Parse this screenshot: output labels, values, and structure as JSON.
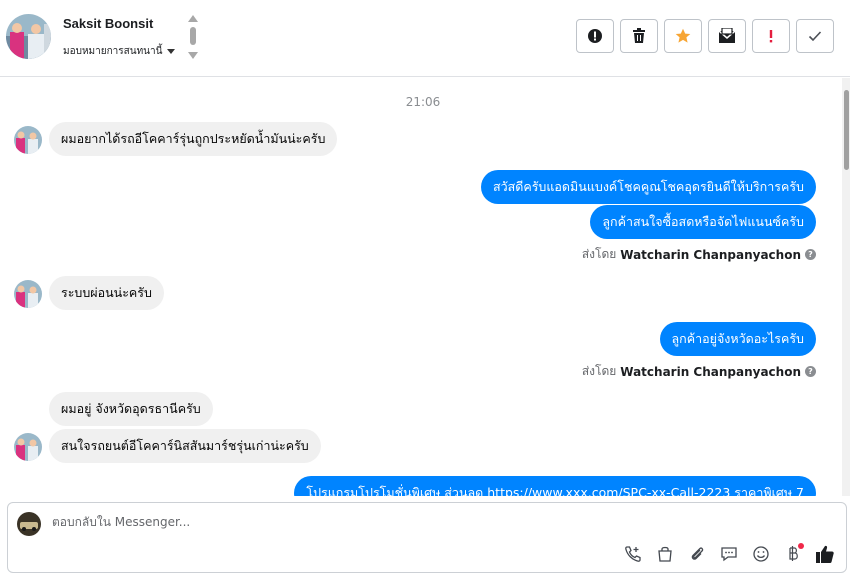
{
  "header": {
    "contact_name": "Saksit Boonsit",
    "assign_label": "มอบหมายการสนทนานี้",
    "actions": [
      {
        "name": "spam-alert-button",
        "icon": "alert-circle-icon"
      },
      {
        "name": "delete-button",
        "icon": "trash-icon"
      },
      {
        "name": "star-button",
        "icon": "star-icon"
      },
      {
        "name": "mark-unread-button",
        "icon": "envelope-icon"
      },
      {
        "name": "follow-up-button",
        "icon": "exclamation-icon"
      },
      {
        "name": "mark-done-button",
        "icon": "checkmark-icon"
      }
    ]
  },
  "chat": {
    "timestamp": "21:06",
    "messages": [
      {
        "dir": "in",
        "text": "ผมอยากได้รถอีโคคาร์รุ่นถูกประหยัดน้ำมันน่ะครับ"
      },
      {
        "dir": "out",
        "text": "สวัสดีครับแอดมินแบงค์โชคคูณโชคอุดรยินดีให้บริการครับ"
      },
      {
        "dir": "out",
        "text": "ลูกค้าสนใจซื้อสดหรือจัดไฟแนนซ์ครับ"
      },
      {
        "dir": "in",
        "text": "ระบบผ่อนน่ะครับ"
      },
      {
        "dir": "out",
        "text": "ลูกค้าอยู่จังหวัดอะไรครับ"
      },
      {
        "dir": "in",
        "text": "ผมอยู่ จังหวัดอุดรธานีครับ"
      },
      {
        "dir": "in",
        "text": "สนใจรถยนต์อีโคคาร์นิสสันมาร์ชรุ่นเก่าน่ะครับ"
      },
      {
        "dir": "out",
        "text": "โปรแกรมโปรโมชั่นพิเศษ ส่วนลด https://www.xxx.com/SPC-xx-Call-2223 ราคาพิเศษ 7"
      }
    ],
    "sent_by_prefix": "ส่งโดย",
    "sent_by_name": "Watcharin Chanpanyachon"
  },
  "composer": {
    "placeholder": "ตอบกลับใน Messenger..."
  },
  "colors": {
    "outgoing_bubble": "#0084ff",
    "incoming_bubble": "#f0f0f0",
    "star": "#f7a534",
    "alert_red": "#e41e3f"
  }
}
